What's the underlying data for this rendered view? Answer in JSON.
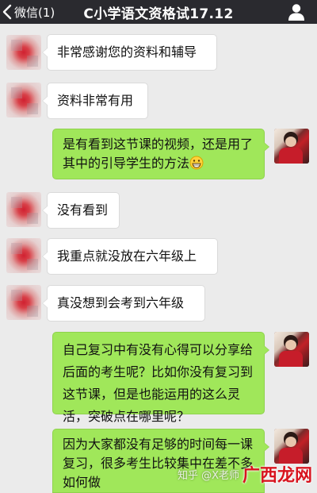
{
  "nav": {
    "back_label": "微信(1)",
    "title": "C小学语文资格试17.12",
    "back_icon": "chevron-left-icon",
    "profile_icon": "person-icon"
  },
  "messages": [
    {
      "side": "left",
      "text": "非常感谢您的资料和辅导"
    },
    {
      "side": "left",
      "text": "资料非常有用"
    },
    {
      "side": "right",
      "text": "是有看到这节课的视频，还是用了其中的引导学生的方法",
      "emoji": "grinning-face-icon"
    },
    {
      "side": "left",
      "text": "没有看到"
    },
    {
      "side": "left",
      "text": "我重点就没放在六年级上"
    },
    {
      "side": "left",
      "text": "真没想到会考到六年级"
    },
    {
      "side": "right",
      "text": "自己复习中有没有心得可以分享给后面的考生呢？比如你没有复习到这节课，但是也能运用的这么灵活，突破点在哪里呢？"
    },
    {
      "side": "right",
      "text": "因为大家都没有足够的时间每一课复习，很多考生比较集中在差不多如何做"
    }
  ],
  "watermark": {
    "site_text": "知乎 @X老师",
    "logo_text": "广西龙网"
  },
  "colors": {
    "nav_bg": "#2a2a2f",
    "chat_bg": "#ebebeb",
    "bubble_right": "#a0e75a",
    "bubble_left": "#ffffff"
  }
}
